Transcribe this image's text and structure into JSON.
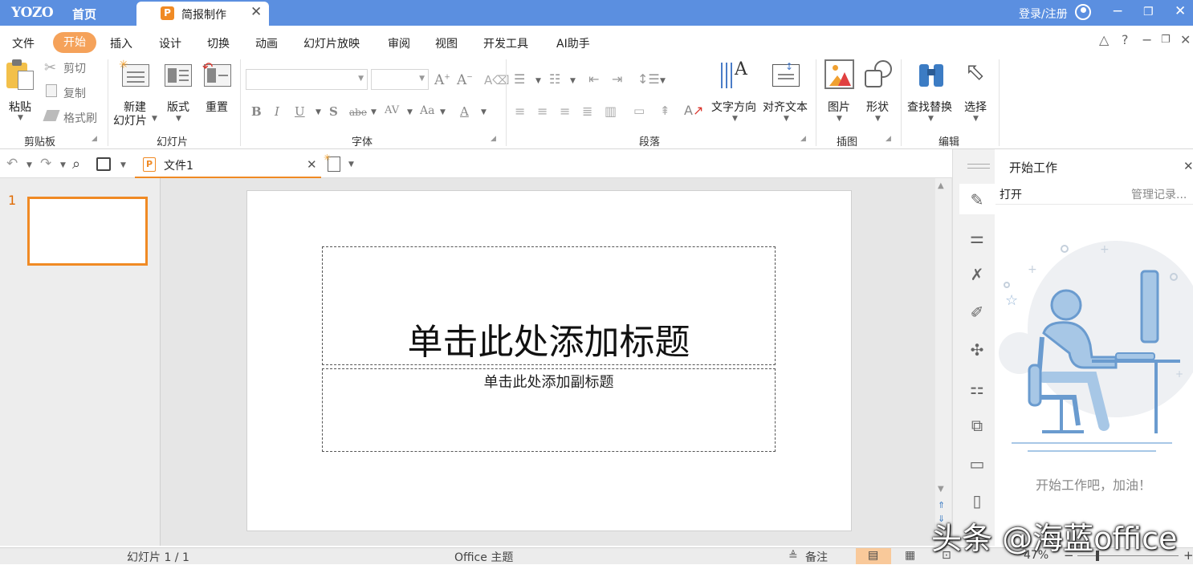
{
  "titlebar": {
    "logo": "YOZO",
    "home": "首页",
    "doc_tab": "简报制作",
    "doc_tab_icon": "P",
    "login": "登录/注册"
  },
  "menu": {
    "items": [
      "文件",
      "开始",
      "插入",
      "设计",
      "切换",
      "动画",
      "幻灯片放映",
      "审阅",
      "视图",
      "开发工具",
      "AI助手"
    ],
    "active": "开始"
  },
  "ribbon": {
    "clipboard": {
      "paste": "粘贴",
      "cut": "剪切",
      "copy": "复制",
      "format_painter": "格式刷",
      "title": "剪贴板"
    },
    "slides": {
      "new_slide_line1": "新建",
      "new_slide_line2": "幻灯片",
      "layout": "版式",
      "reset": "重置",
      "title": "幻灯片"
    },
    "font": {
      "title": "字体",
      "font_name": "",
      "font_size": ""
    },
    "paragraph": {
      "text_direction": "文字方向",
      "align_text": "对齐文本",
      "title": "段落"
    },
    "illustrations": {
      "picture": "图片",
      "shape": "形状",
      "title": "插图"
    },
    "editing": {
      "find_replace": "查找替换",
      "select": "选择",
      "title": "编辑"
    }
  },
  "toolbar": {
    "file_tab": "文件1"
  },
  "slide_panel": {
    "slide_number": "1"
  },
  "slide": {
    "title_placeholder": "单击此处添加标题",
    "subtitle_placeholder": "单击此处添加副标题"
  },
  "right_panel": {
    "title": "开始工作",
    "open": "打开",
    "manage": "管理记录...",
    "encourage": "开始工作吧，加油！"
  },
  "status": {
    "slide_count": "幻灯片 1 / 1",
    "theme": "Office 主题",
    "notes": "备注",
    "zoom": "47%"
  },
  "watermark": "头条 @海蓝office",
  "colors": {
    "titlebar": "#5b8fe0",
    "accent": "#f08a24",
    "active_menu": "#f5a25a"
  }
}
